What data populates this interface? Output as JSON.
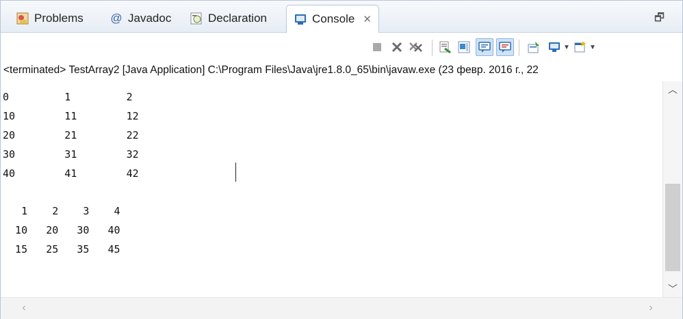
{
  "tabs": [
    {
      "label": "Problems",
      "icon": "problems-icon"
    },
    {
      "label": "Javadoc",
      "icon": "javadoc-icon"
    },
    {
      "label": "Declaration",
      "icon": "declaration-icon"
    },
    {
      "label": "Console",
      "icon": "console-icon",
      "active": true
    }
  ],
  "status": "<terminated> TestArray2 [Java Application] C:\\Program Files\\Java\\jre1.8.0_65\\bin\\javaw.exe (23 февр. 2016 г., 22",
  "console_lines": [
    "0         1         2",
    "10        11        12",
    "20        21        22",
    "30        31        32",
    "40        41        42",
    "",
    "   1    2    3    4",
    "  10   20   30   40",
    "  15   25   35   45"
  ],
  "colors": {
    "accent": "#2a6db5",
    "terminate_red": "#c0392b"
  }
}
